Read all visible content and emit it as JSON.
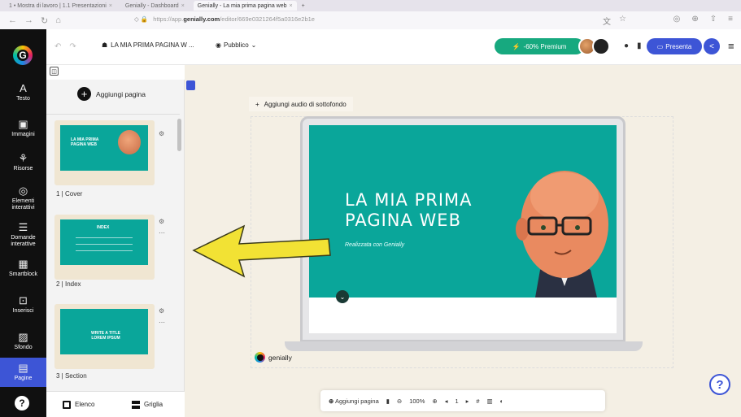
{
  "browser": {
    "tabs": [
      "1 • Mostra di lavoro | 1.1 Presentazioni",
      "Genially - Dashboard",
      "Genially - La mia prima pagina web"
    ],
    "url_prefix": "https://app.",
    "url_domain": "genially.com",
    "url_path": "/editor/669e0321264f5a0316e2b1e"
  },
  "rail": {
    "items": [
      {
        "label": "Testo",
        "icon": "A"
      },
      {
        "label": "Immagini",
        "icon": "▣"
      },
      {
        "label": "Risorse",
        "icon": "⚘"
      },
      {
        "label": "Elementi interattivi",
        "icon": "◎"
      },
      {
        "label": "Domande interattive",
        "icon": "☰"
      },
      {
        "label": "Smartblock",
        "icon": "▦"
      },
      {
        "label": "Inserisci",
        "icon": "⊡"
      },
      {
        "label": "Sfondo",
        "icon": "▨"
      },
      {
        "label": "Pagine",
        "icon": "▤"
      }
    ]
  },
  "toolbar": {
    "title": "LA MIA PRIMA PAGINA W ...",
    "visibility": "Pubblico",
    "premium": "-60% Premium",
    "present": "Presenta"
  },
  "pages": {
    "add_label": "Aggiungi pagina",
    "items": [
      {
        "label": "1 | Cover",
        "thumb": "LA MIA PRIMA PAGINA WEB"
      },
      {
        "label": "2 | Index",
        "thumb": "INDEX"
      },
      {
        "label": "3 | Section",
        "thumb": "WRITE A TITLE LOREM IPSUM"
      }
    ],
    "view_list": "Elenco",
    "view_grid": "Griglia"
  },
  "canvas": {
    "add_audio": "Aggiungi audio di sottofondo",
    "slide_title_1": "LA MIA PRIMA",
    "slide_title_2": "PAGINA WEB",
    "slide_subtitle": "Realizzata con Genially",
    "watermark": "genially"
  },
  "bottom": {
    "add_page": "Aggiungi pagina",
    "zoom": "100%",
    "page": "1"
  },
  "colors": {
    "accent": "#3d55d6",
    "teal": "#0aa69a",
    "premium": "#17a97f",
    "arrow": "#f2e234"
  }
}
